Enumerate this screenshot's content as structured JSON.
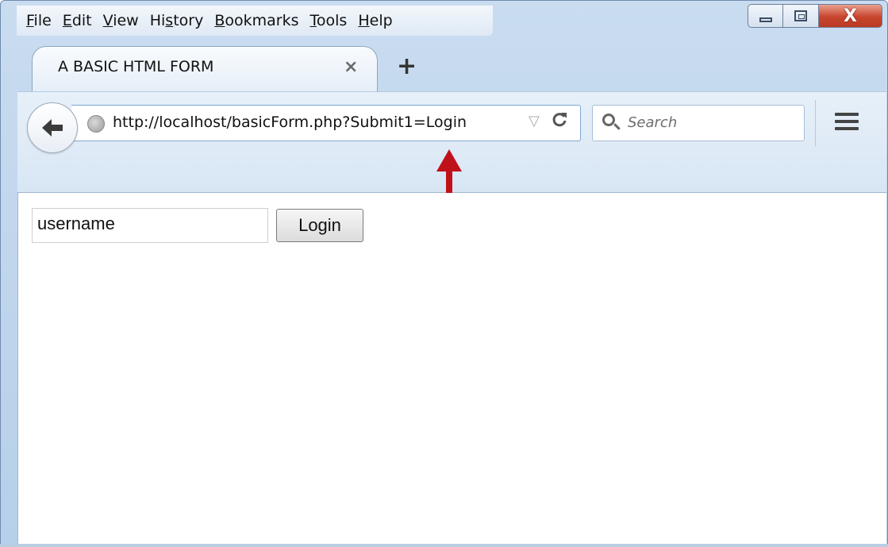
{
  "menubar": {
    "items": [
      {
        "pre": "",
        "accel": "F",
        "post": "ile"
      },
      {
        "pre": "",
        "accel": "E",
        "post": "dit"
      },
      {
        "pre": "",
        "accel": "V",
        "post": "iew"
      },
      {
        "pre": "Hi",
        "accel": "s",
        "post": "tory"
      },
      {
        "pre": "",
        "accel": "B",
        "post": "ookmarks"
      },
      {
        "pre": "",
        "accel": "T",
        "post": "ools"
      },
      {
        "pre": "",
        "accel": "H",
        "post": "elp"
      }
    ]
  },
  "window_controls": {
    "close_glyph": "X",
    "close_color": "#c8452d"
  },
  "tab": {
    "title": "A BASIC HTML FORM",
    "close_glyph": "×",
    "new_tab_glyph": "+"
  },
  "navbar": {
    "back_glyph": "🡠",
    "url": "http://localhost/basicForm.php?Submit1=Login",
    "url_dropdown_glyph": "▽",
    "reload_glyph": "C",
    "search_placeholder": "Search",
    "annotation_color": "#c0111a"
  },
  "page": {
    "username_value": "username",
    "login_label": "Login"
  },
  "icons": [
    "back-arrow-icon",
    "globe-icon",
    "dropdown-icon",
    "reload-icon",
    "search-icon",
    "hamburger-menu-icon",
    "minimize-icon",
    "maximize-icon",
    "close-icon"
  ]
}
